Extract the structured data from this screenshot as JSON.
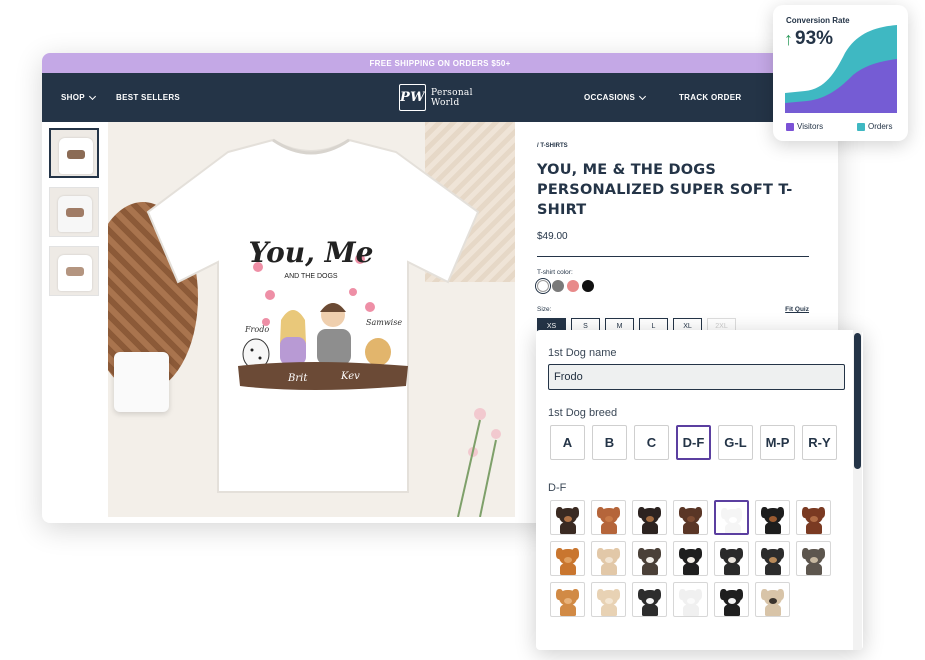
{
  "promo_text": "FREE SHIPPING ON ORDERS $50+",
  "nav": {
    "shop": "SHOP",
    "best_sellers": "BEST SELLERS",
    "occasions": "OCCASIONS",
    "track_order": "TRACK ORDER",
    "logo_mark": "PW",
    "logo_text": "Personal World"
  },
  "shirt_art": {
    "headline": "You, Me",
    "sub": "AND THE DOGS",
    "names": [
      "Frodo",
      "Samwise",
      "Brit",
      "Kev"
    ]
  },
  "product": {
    "breadcrumb": "/ T-SHIRTS",
    "title": "YOU, ME & THE DOGS PERSONALIZED SUPER SOFT T-SHIRT",
    "price": "$49.00",
    "color_label": "T-shirt color:",
    "colors": [
      "#ffffff",
      "#7a7a7a",
      "#e88a8a",
      "#111111"
    ],
    "size_label": "Size:",
    "fit_quiz": "Fit Quiz",
    "sizes": [
      "XS",
      "S",
      "M",
      "L",
      "XL",
      "2XL"
    ],
    "selected_size": "XS",
    "disabled_size": "2XL"
  },
  "conversion": {
    "title": "Conversion Rate",
    "value": "93%",
    "legend": [
      {
        "label": "Visitors",
        "color": "#7b52d6"
      },
      {
        "label": "Orders",
        "color": "#3fb8c2"
      }
    ]
  },
  "customizer": {
    "dog_name_label": "1st Dog name",
    "dog_name_value": "Frodo",
    "breed_label": "1st Dog breed",
    "breed_ranges": [
      "A",
      "B",
      "C",
      "D-F",
      "G-L",
      "M-P",
      "R-Y"
    ],
    "selected_range": "D-F",
    "range_heading": "D-F",
    "dogs": [
      {
        "breed": "dachshund-black-tan",
        "fur": "#3a2a22",
        "face": "#b07246",
        "selected": false
      },
      {
        "breed": "dachshund-red",
        "fur": "#b5653a",
        "face": "#c97a48",
        "selected": false
      },
      {
        "breed": "dachshund-long-black",
        "fur": "#2c2320",
        "face": "#a06a40",
        "selected": false
      },
      {
        "breed": "dachshund-chocolate",
        "fur": "#5a3626",
        "face": "#7e4c33",
        "selected": false
      },
      {
        "breed": "dalmatian",
        "fur": "#f5f5f5",
        "face": "#ffffff",
        "selected": true
      },
      {
        "breed": "doberman-black",
        "fur": "#1d1d1d",
        "face": "#9a5a30",
        "selected": false
      },
      {
        "breed": "doberman-red",
        "fur": "#7a3a22",
        "face": "#b06c45",
        "selected": false
      },
      {
        "breed": "english-golden-retriever",
        "fur": "#c9762f",
        "face": "#e0a060",
        "selected": false
      },
      {
        "breed": "english-bulldog-fawn",
        "fur": "#e2c8a8",
        "face": "#f2e4d2",
        "selected": false
      },
      {
        "breed": "english-bulldog-brindle",
        "fur": "#4a4038",
        "face": "#f0ece6",
        "selected": false
      },
      {
        "breed": "entlebucher",
        "fur": "#1f1f1f",
        "face": "#f3efe8",
        "selected": false
      },
      {
        "breed": "english-springer",
        "fur": "#2a2a2a",
        "face": "#e9e4dc",
        "selected": false
      },
      {
        "breed": "eurasier-black",
        "fur": "#2c2c2c",
        "face": "#b88a5a",
        "selected": false
      },
      {
        "breed": "eurasier-wolf",
        "fur": "#5d564e",
        "face": "#c7b8a0",
        "selected": false
      },
      {
        "breed": "finnish-spitz",
        "fur": "#d18a45",
        "face": "#e8b27a",
        "selected": false
      },
      {
        "breed": "french-bulldog-fawn",
        "fur": "#e8d2b4",
        "face": "#f4e6d2",
        "selected": false
      },
      {
        "breed": "french-bulldog-pied",
        "fur": "#2d2d2d",
        "face": "#f4f4f4",
        "selected": false
      },
      {
        "breed": "french-bulldog-white",
        "fur": "#f0f0f0",
        "face": "#fafafa",
        "selected": false
      },
      {
        "breed": "french-bulldog-black",
        "fur": "#1f1f1f",
        "face": "#f2f2f2",
        "selected": false
      },
      {
        "breed": "french-bulldog-cream",
        "fur": "#d8c4a8",
        "face": "#3a332d",
        "selected": false
      }
    ]
  }
}
